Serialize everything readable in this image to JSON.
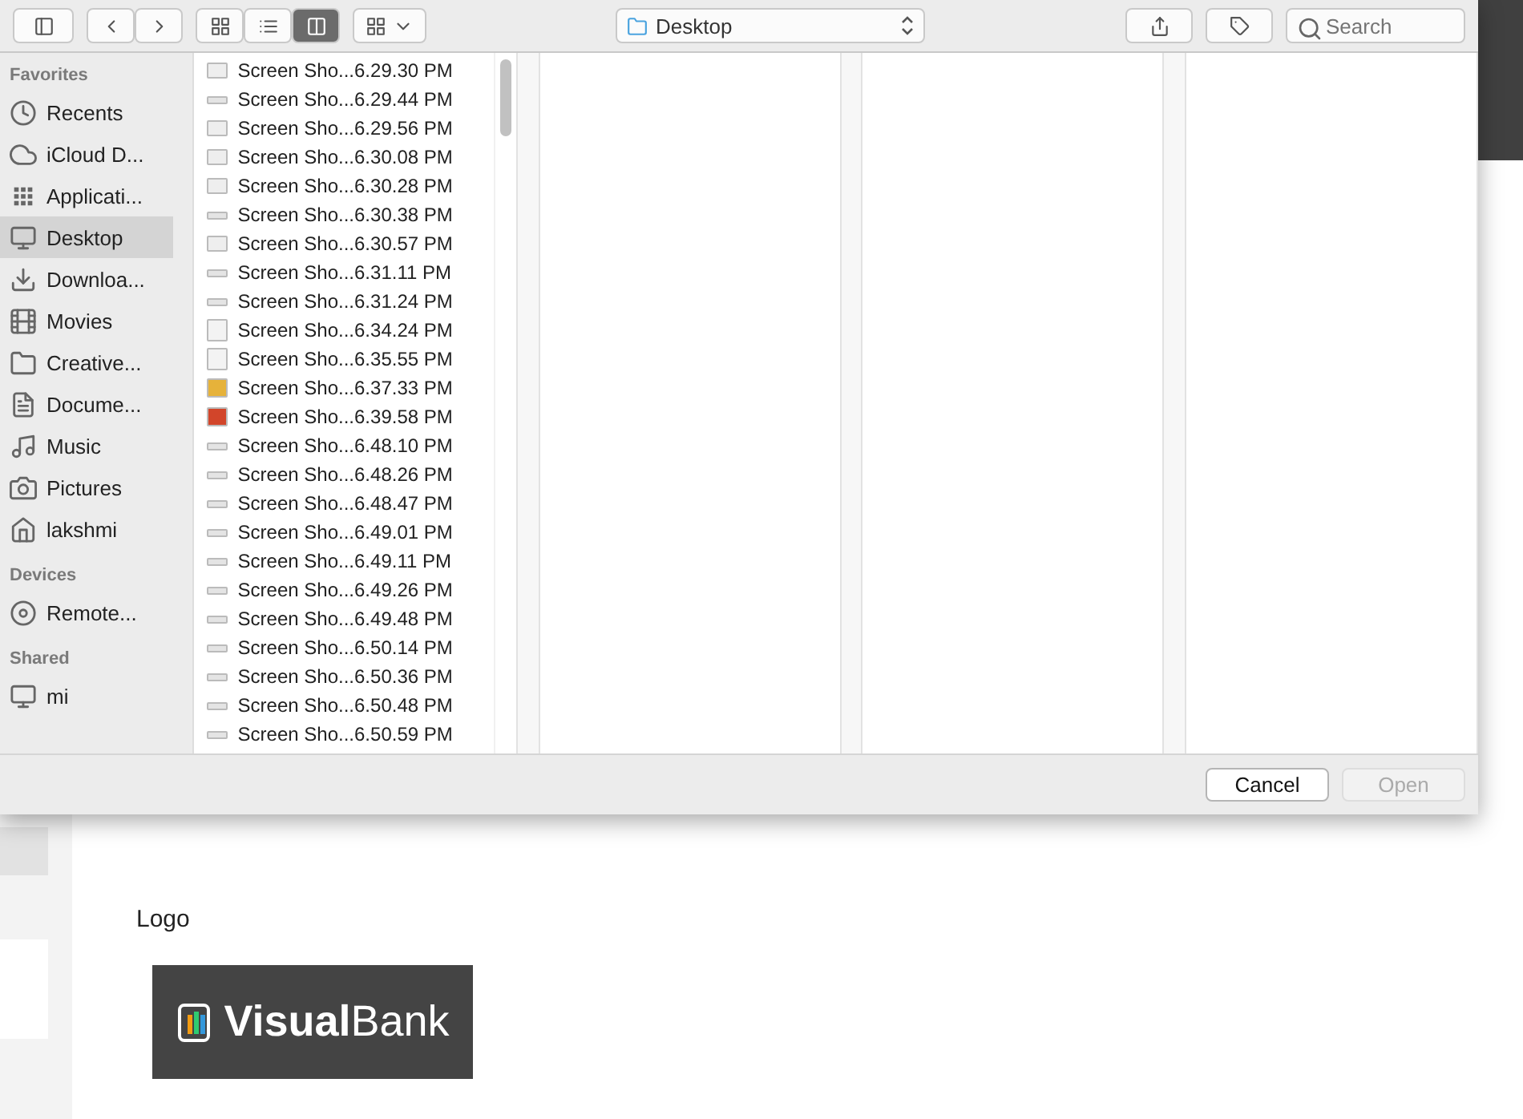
{
  "toolbar": {
    "location": "Desktop",
    "search": {
      "placeholder": "Search"
    },
    "view_modes": [
      {
        "kind": "icons",
        "selected": false
      },
      {
        "kind": "list",
        "selected": false
      },
      {
        "kind": "columns",
        "selected": true
      }
    ]
  },
  "sidebar": {
    "sections": [
      {
        "heading": "Favorites",
        "items": [
          {
            "label": "Recents",
            "kind": "recents",
            "selected": false
          },
          {
            "label": "iCloud D...",
            "kind": "cloud",
            "selected": false
          },
          {
            "label": "Applicati...",
            "kind": "apps",
            "selected": false
          },
          {
            "label": "Desktop",
            "kind": "desktop",
            "selected": true
          },
          {
            "label": "Downloa...",
            "kind": "download",
            "selected": false
          },
          {
            "label": "Movies",
            "kind": "film",
            "selected": false
          },
          {
            "label": "Creative...",
            "kind": "folder",
            "selected": false
          },
          {
            "label": "Docume...",
            "kind": "document",
            "selected": false
          },
          {
            "label": "Music",
            "kind": "music",
            "selected": false
          },
          {
            "label": "Pictures",
            "kind": "camera",
            "selected": false
          },
          {
            "label": "lakshmi",
            "kind": "home",
            "selected": false
          }
        ]
      },
      {
        "heading": "Devices",
        "items": [
          {
            "label": "Remote...",
            "kind": "disc",
            "selected": false
          }
        ]
      },
      {
        "heading": "Shared",
        "items": [
          {
            "label": "mi",
            "kind": "monitor",
            "selected": false
          }
        ]
      }
    ]
  },
  "files": [
    {
      "name": "Screen Sho...6.29.30 PM",
      "kind": "screen"
    },
    {
      "name": "Screen Sho...6.29.44 PM",
      "kind": "strip"
    },
    {
      "name": "Screen Sho...6.29.56 PM",
      "kind": "screen"
    },
    {
      "name": "Screen Sho...6.30.08 PM",
      "kind": "screen"
    },
    {
      "name": "Screen Sho...6.30.28 PM",
      "kind": "screen"
    },
    {
      "name": "Screen Sho...6.30.38 PM",
      "kind": "strip"
    },
    {
      "name": "Screen Sho...6.30.57 PM",
      "kind": "screen"
    },
    {
      "name": "Screen Sho...6.31.11 PM",
      "kind": "strip"
    },
    {
      "name": "Screen Sho...6.31.24 PM",
      "kind": "strip"
    },
    {
      "name": "Screen Sho...6.34.24 PM",
      "kind": "page"
    },
    {
      "name": "Screen Sho...6.35.55 PM",
      "kind": "page"
    },
    {
      "name": "Screen Sho...6.37.33 PM",
      "kind": "photo-yellow"
    },
    {
      "name": "Screen Sho...6.39.58 PM",
      "kind": "photo-red"
    },
    {
      "name": "Screen Sho...6.48.10 PM",
      "kind": "strip"
    },
    {
      "name": "Screen Sho...6.48.26 PM",
      "kind": "strip"
    },
    {
      "name": "Screen Sho...6.48.47 PM",
      "kind": "strip"
    },
    {
      "name": "Screen Sho...6.49.01 PM",
      "kind": "strip"
    },
    {
      "name": "Screen Sho...6.49.11 PM",
      "kind": "strip"
    },
    {
      "name": "Screen Sho...6.49.26 PM",
      "kind": "strip"
    },
    {
      "name": "Screen Sho...6.49.48 PM",
      "kind": "strip"
    },
    {
      "name": "Screen Sho...6.50.14 PM",
      "kind": "strip"
    },
    {
      "name": "Screen Sho...6.50.36 PM",
      "kind": "strip"
    },
    {
      "name": "Screen Sho...6.50.48 PM",
      "kind": "strip"
    },
    {
      "name": "Screen Sho...6.50.59 PM",
      "kind": "strip"
    }
  ],
  "buttons": [
    {
      "label": "Cancel",
      "disabled": false
    },
    {
      "label": "Open",
      "disabled": true
    }
  ],
  "page": {
    "section_label": "Logo",
    "logo": "**Visual**Bank"
  }
}
